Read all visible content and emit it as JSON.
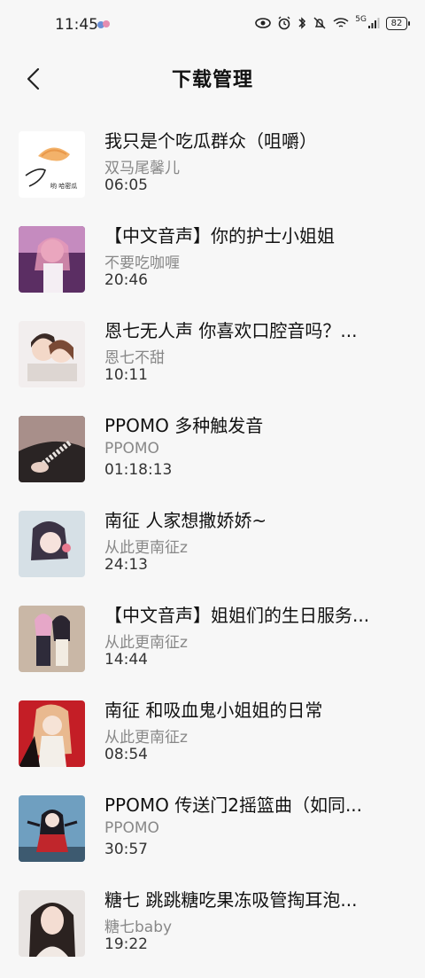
{
  "status": {
    "time": "11:45",
    "network": "5G",
    "battery": "82"
  },
  "header": {
    "title": "下载管理"
  },
  "items": [
    {
      "title": "我只是个吃瓜群众（咀嚼）",
      "author": "双马尾馨儿",
      "duration": "06:05",
      "thumb_caption": "哟 哈密瓜"
    },
    {
      "title": "【中文音声】你的护士小姐姐",
      "author": "不要吃咖喱",
      "duration": "20:46"
    },
    {
      "title": "恩七无人声 你喜欢口腔音吗？...",
      "author": "恩七不甜",
      "duration": "10:11"
    },
    {
      "title": "PPOMO 多种触发音",
      "author": "PPOMO",
      "duration": "01:18:13"
    },
    {
      "title": "南征 人家想撒娇娇~",
      "author": "从此更南征z",
      "duration": "24:13"
    },
    {
      "title": "【中文音声】姐姐们的生日服务...",
      "author": "从此更南征z",
      "duration": "14:44"
    },
    {
      "title": "南征 和吸血鬼小姐姐的日常",
      "author": "从此更南征z",
      "duration": "08:54"
    },
    {
      "title": "PPOMO 传送门2摇篮曲（如同...",
      "author": "PPOMO",
      "duration": "30:57"
    },
    {
      "title": "糖七 跳跳糖吃果冻吸管掏耳泡...",
      "author": "糖七baby",
      "duration": "19:22"
    }
  ]
}
